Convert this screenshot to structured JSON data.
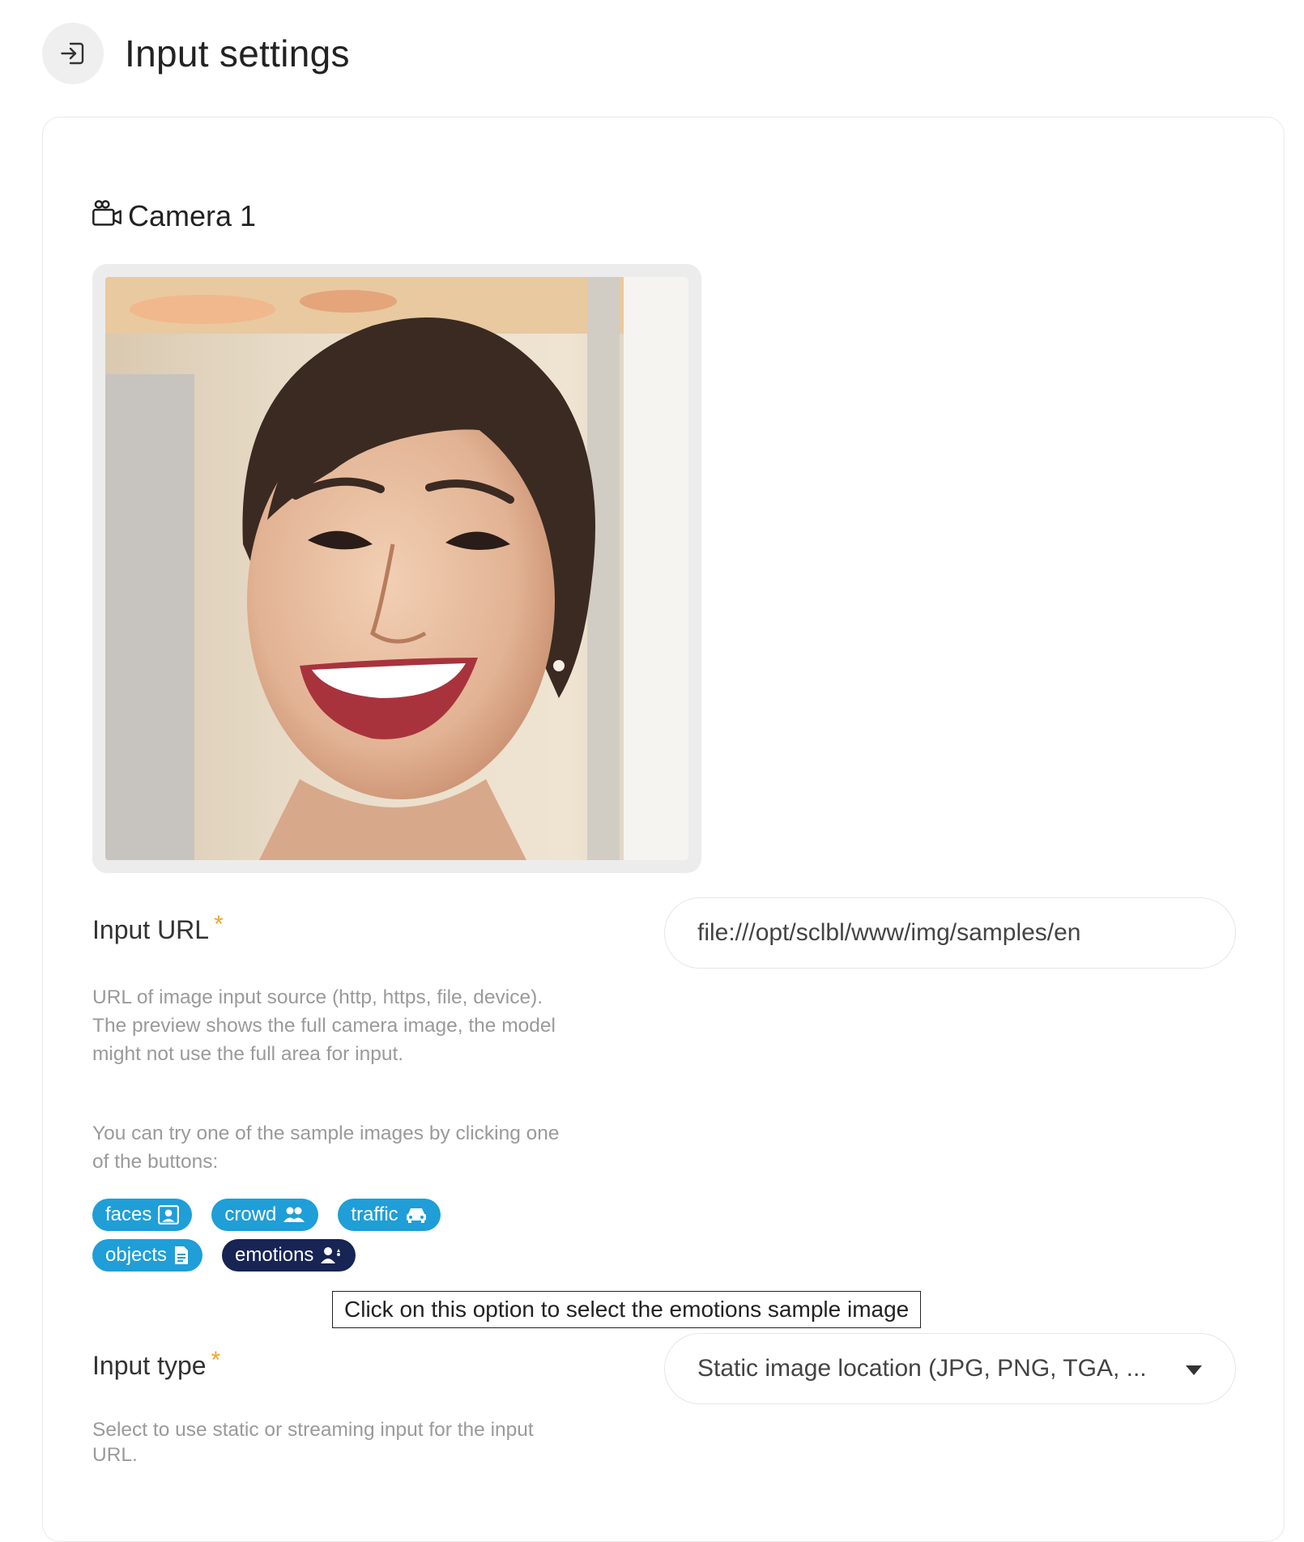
{
  "header": {
    "title": "Input settings",
    "icon": "sign-in-icon"
  },
  "camera": {
    "title": "Camera 1",
    "icon": "video-camera-icon",
    "preview_alt": "camera preview image"
  },
  "input_url": {
    "label": "Input URL",
    "required_mark": "*",
    "value": "file:///opt/sclbl/www/img/samples/en",
    "help": "URL of image input source (http, https, file, device). The preview shows the full camera image, the model might not use the full area for input.",
    "samples_help": "You can try one of the sample images by clicking one of the buttons:"
  },
  "samples": [
    {
      "label": "faces",
      "icon": "portrait-icon",
      "active": false
    },
    {
      "label": "crowd",
      "icon": "users-icon",
      "active": false
    },
    {
      "label": "traffic",
      "icon": "car-icon",
      "active": false
    },
    {
      "label": "objects",
      "icon": "document-icon",
      "active": false
    },
    {
      "label": "emotions",
      "icon": "user-emotion-icon",
      "active": true
    }
  ],
  "tooltip": "Click on this option to select the emotions sample image",
  "input_type": {
    "label": "Input type",
    "required_mark": "*",
    "value": "Static image location (JPG, PNG, TGA, ...",
    "help": "Select to use static or streaming input for the input URL."
  },
  "colors": {
    "chip": "#1f9ed8",
    "chip_active": "#172454",
    "required": "#f5a623"
  }
}
